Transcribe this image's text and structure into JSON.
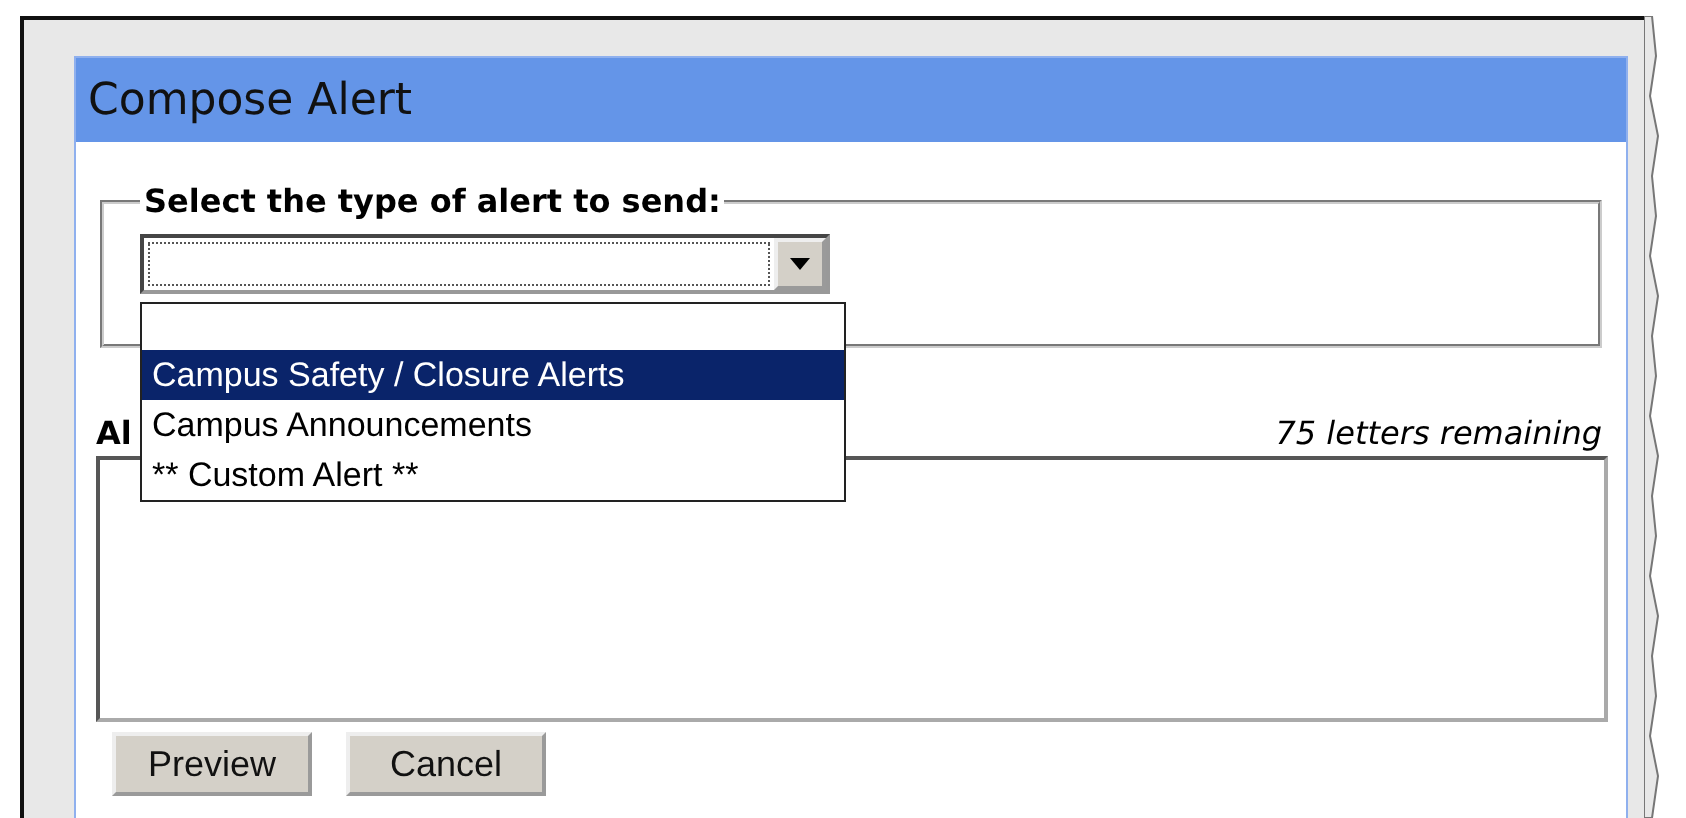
{
  "panel": {
    "title": "Compose Alert"
  },
  "alert_type": {
    "legend": "Select the type of alert to send:",
    "expanded": true,
    "options": [
      {
        "label": "Campus Safety / Closure Alerts",
        "selected": true
      },
      {
        "label": "Campus Announcements",
        "selected": false
      },
      {
        "label": "** Custom Alert **",
        "selected": false
      }
    ]
  },
  "message": {
    "label": "Al",
    "counter": "75 letters remaining"
  },
  "buttons": [
    "Preview",
    "Cancel"
  ]
}
